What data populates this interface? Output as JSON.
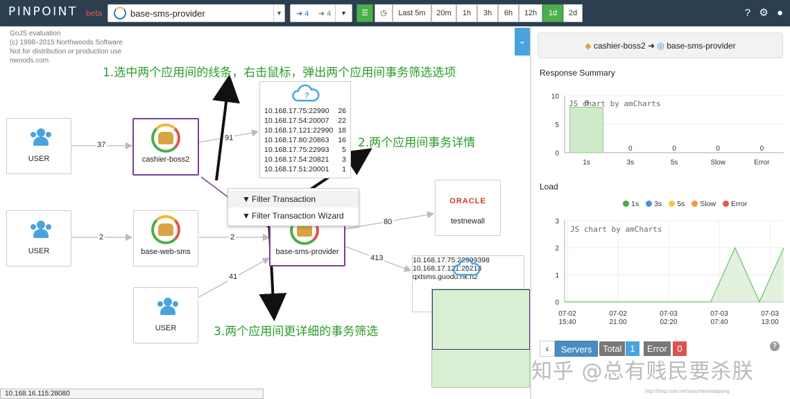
{
  "topbar": {
    "logo": "PINPOINT",
    "beta": "beta",
    "app_selected": "base-sms-provider",
    "depth_in": "➜ 4",
    "depth_out": "➜ 4",
    "time_buttons": [
      "Last 5m",
      "20m",
      "1h",
      "3h",
      "6h",
      "12h",
      "1d",
      "2d"
    ],
    "active_time": "1d"
  },
  "gojs": {
    "line1": "GoJS evaluation",
    "line2": "(c) 1998–2015 Northwoods Software",
    "line3": "Not for distribution or production use",
    "line4": "nwoods.com"
  },
  "nodes": {
    "user1": "USER",
    "user2": "USER",
    "user3": "USER",
    "cashier": "cashier-boss2",
    "webSms": "base-web-sms",
    "provider": "base-sms-provider",
    "oracle_brand": "ORACLE",
    "oracle_name": "testnewall"
  },
  "edges": {
    "e1": "37",
    "e2": "91",
    "e3": "2",
    "e4": "2",
    "e5": "41",
    "e6": "80",
    "e7": "413"
  },
  "tooltip1": [
    {
      "ip": "10.168.17.75:22990",
      "count": "26"
    },
    {
      "ip": "10.168.17.54:20007",
      "count": "22"
    },
    {
      "ip": "10.168.17.121:22990",
      "count": "18"
    },
    {
      "ip": "10.168.17.80:20863",
      "count": "16"
    },
    {
      "ip": "10.168.17.75:22993",
      "count": "5"
    },
    {
      "ip": "10.168.17.54:20821",
      "count": "3"
    },
    {
      "ip": "10.168.17.51:20001",
      "count": "1"
    }
  ],
  "tooltip2": [
    {
      "ip": "10.168.17.75:22999",
      "count": "398"
    },
    {
      "ip": "10.168.17.121:202",
      "count": "13"
    },
    {
      "ip": "qxtsms.guodu.nk.n",
      "count": "2"
    }
  ],
  "context_menu": {
    "item1": "Filter Transaction",
    "item2": "Filter Transaction Wizard"
  },
  "annotations": {
    "a1": "1.选中两个应用间的线条，右击鼠标，弹出两个应用间事务筛选选项",
    "a2": "2.两个应用间事务详情",
    "a3": "3.两个应用间更详细的事务筛选"
  },
  "statusbar": "10.168.16.115:28080",
  "right_panel": {
    "from": "cashier-boss2",
    "to": "base-sms-provider",
    "response_title": "Response Summary",
    "load_title": "Load",
    "amcharts": "JS chart by amCharts",
    "legend": [
      "1s",
      "3s",
      "5s",
      "Slow",
      "Error"
    ],
    "servers_tab": "Servers",
    "total_label": "Total",
    "total_count": "1",
    "error_label": "Error",
    "error_count": "0"
  },
  "colors": {
    "1s": "#44aa44",
    "3s": "#4a8fdc",
    "5s": "#f5c842",
    "Slow": "#f29b3a",
    "Error": "#e0564a"
  },
  "chart_data": [
    {
      "type": "bar",
      "title": "Response Summary",
      "categories": [
        "1s",
        "3s",
        "5s",
        "Slow",
        "Error"
      ],
      "values": [
        8,
        0,
        0,
        0,
        0
      ],
      "ylim": [
        0,
        10
      ],
      "yticks": [
        0,
        5,
        10
      ]
    },
    {
      "type": "area",
      "title": "Load",
      "x_ticks": [
        "07-02 15:40",
        "07-02 21:00",
        "07-03 02:20",
        "07-03 07:40",
        "07-03 13:00"
      ],
      "ylim": [
        0,
        3
      ],
      "yticks": [
        0,
        1,
        2,
        3
      ],
      "series": [
        {
          "name": "1s",
          "values": [
            0,
            0,
            0,
            0,
            0,
            0,
            0,
            2,
            0,
            2
          ]
        }
      ]
    }
  ],
  "watermark": "知乎 @总有贱民要杀朕",
  "watermark_url": "http://blog.csdn.net/xiaozhaoxiadapang"
}
